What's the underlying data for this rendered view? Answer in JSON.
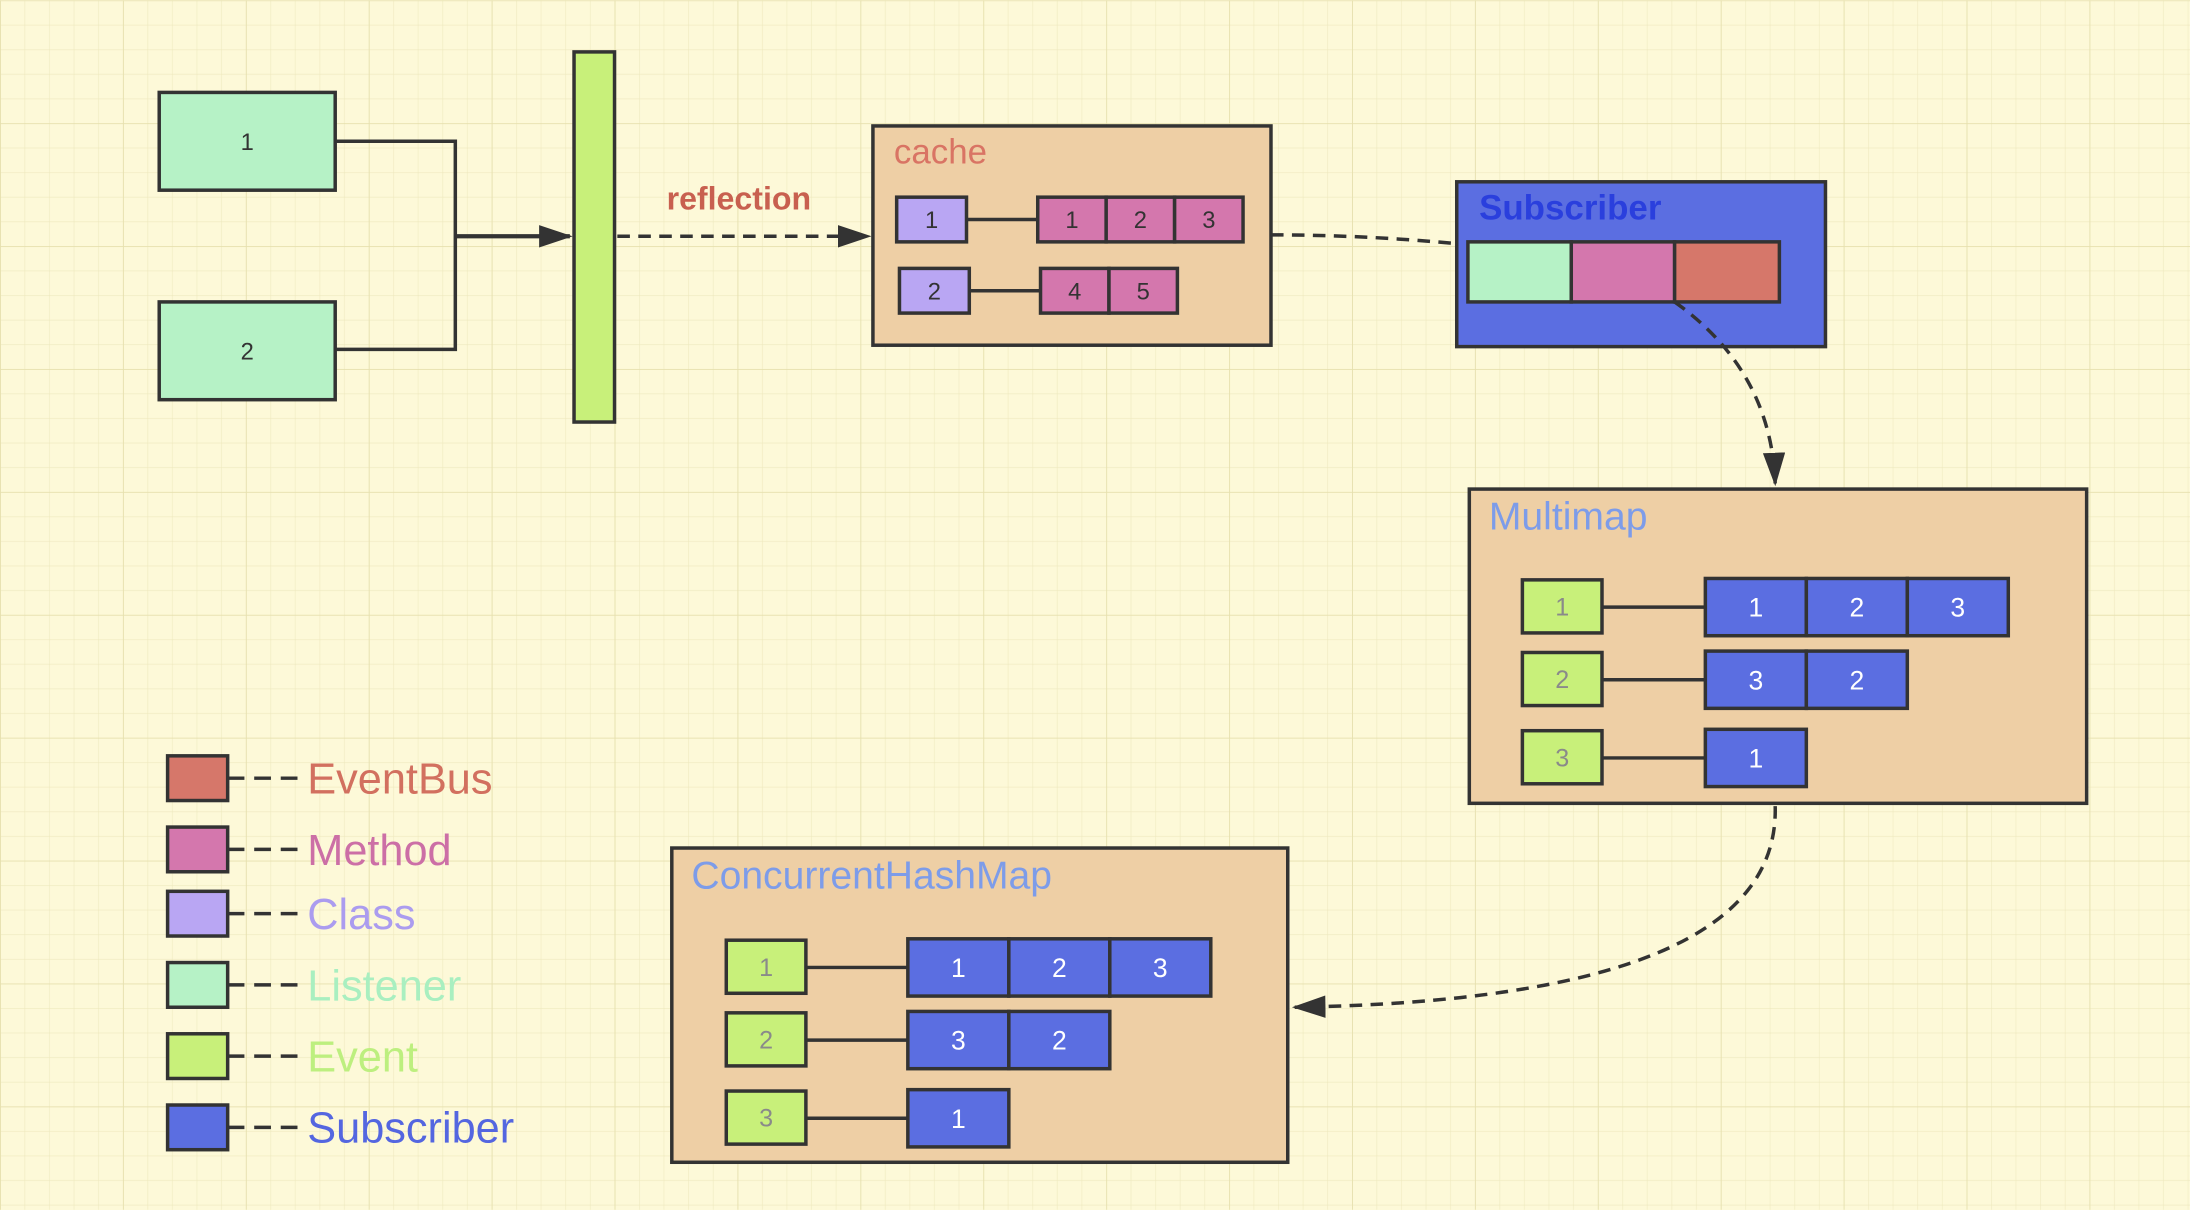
{
  "colors": {
    "background": "#fdf9d8",
    "grid": "#ede8bd",
    "container": "#eecfa5",
    "listener": "#b6f2c6",
    "event": "#c8f07a",
    "class": "#b9a6f3",
    "method": "#d477ad",
    "eventbus": "#d6776a",
    "subscriber": "#5b6ee1",
    "stroke": "#333333"
  },
  "listeners": [
    "1",
    "2"
  ],
  "reflection_label": "reflection",
  "cache": {
    "title": "cache",
    "rows": [
      {
        "class": "1",
        "methods": [
          "1",
          "2",
          "3"
        ]
      },
      {
        "class": "2",
        "methods": [
          "4",
          "5"
        ]
      }
    ]
  },
  "subscriber_box": {
    "title": "Subscriber"
  },
  "multimap": {
    "title": "Multimap",
    "rows": [
      {
        "event": "1",
        "subscribers": [
          "1",
          "2",
          "3"
        ]
      },
      {
        "event": "2",
        "subscribers": [
          "3",
          "2"
        ]
      },
      {
        "event": "3",
        "subscribers": [
          "1"
        ]
      }
    ]
  },
  "concurrent_hash_map": {
    "title": "ConcurrentHashMap",
    "rows": [
      {
        "event": "1",
        "subscribers": [
          "1",
          "2",
          "3"
        ]
      },
      {
        "event": "2",
        "subscribers": [
          "3",
          "2"
        ]
      },
      {
        "event": "3",
        "subscribers": [
          "1"
        ]
      }
    ]
  },
  "legend": [
    {
      "label": "EventBus",
      "color": "#d6776a",
      "text_color": "#d2705f"
    },
    {
      "label": "Method",
      "color": "#d477ad",
      "text_color": "#cc6fa6"
    },
    {
      "label": "Class",
      "color": "#b9a6f3",
      "text_color": "#ab9cef"
    },
    {
      "label": "Listener",
      "color": "#b6f2c6",
      "text_color": "#a9efc0"
    },
    {
      "label": "Event",
      "color": "#c8f07a",
      "text_color": "#bdef7f"
    },
    {
      "label": "Subscriber",
      "color": "#5b6ee1",
      "text_color": "#5466e0"
    }
  ]
}
